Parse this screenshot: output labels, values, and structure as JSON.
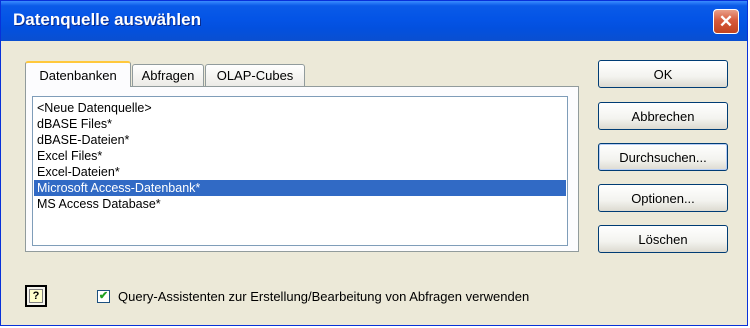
{
  "window": {
    "title": "Datenquelle auswählen",
    "close_symbol": "✕"
  },
  "tabs": [
    {
      "label": "Datenbanken",
      "active": true
    },
    {
      "label": "Abfragen",
      "active": false
    },
    {
      "label": "OLAP-Cubes",
      "active": false
    }
  ],
  "datasources": {
    "items": [
      "<Neue Datenquelle>",
      "dBASE Files*",
      "dBASE-Dateien*",
      "Excel Files*",
      "Excel-Dateien*",
      "Microsoft Access-Datenbank*",
      "MS Access Database*"
    ],
    "selected": "Microsoft Access-Datenbank*"
  },
  "buttons": {
    "ok": "OK",
    "cancel": "Abbrechen",
    "browse": "Durchsuchen...",
    "options": "Optionen...",
    "delete": "Löschen"
  },
  "help": {
    "icon": "help-icon",
    "glyph": "?"
  },
  "query_wizard": {
    "label": "Query-Assistenten zur Erstellung/Bearbeitung von Abfragen verwenden",
    "checked": true,
    "check_glyph": "✔"
  },
  "colors": {
    "titlebar": "#0454e6",
    "selection": "#316ac5",
    "dialog_bg": "#ece9d8"
  }
}
